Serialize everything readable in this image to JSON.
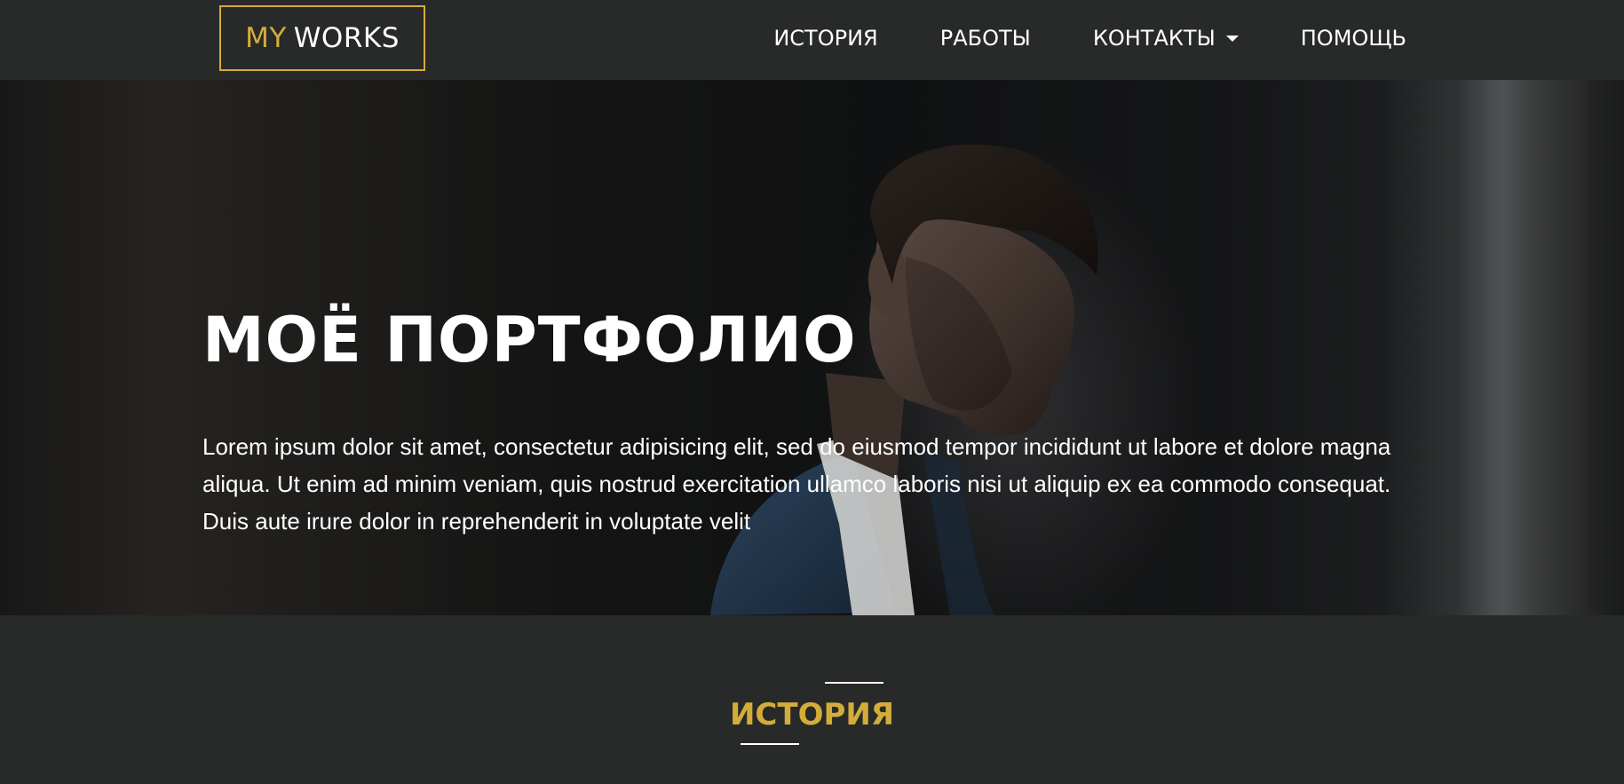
{
  "logo": {
    "part1": "MY",
    "part2": "WORKS"
  },
  "nav": {
    "items": [
      {
        "label": "ИСТОРИЯ"
      },
      {
        "label": "РАБОТЫ"
      },
      {
        "label": "КОНТАКТЫ"
      },
      {
        "label": "ПОМОЩЬ"
      }
    ]
  },
  "hero": {
    "title": "МОЁ ПОРТФОЛИО",
    "text": "Lorem ipsum dolor sit amet, consectetur adipisicing elit, sed do eiusmod tempor incididunt ut labore et dolore magna aliqua. Ut enim ad minim veniam, quis nostrud exercitation ullamco laboris nisi ut aliquip ex ea commodo consequat. Duis aute irure dolor in reprehenderit in voluptate velit"
  },
  "section": {
    "title": "ИСТОРИЯ"
  },
  "colors": {
    "accent": "#d4ac3a",
    "background": "#272a28",
    "text": "#ffffff"
  },
  "icons": {
    "dropdown": "caret-down-icon"
  }
}
